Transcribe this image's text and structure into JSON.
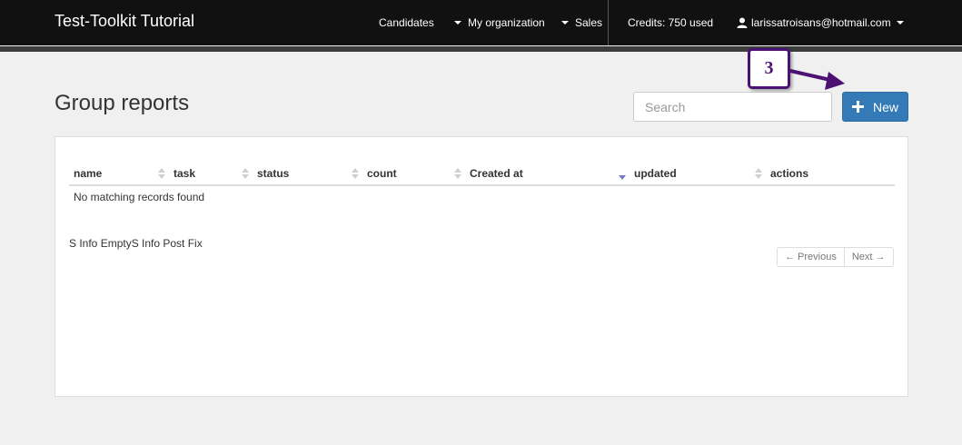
{
  "navbar": {
    "brand": "Test-Toolkit Tutorial",
    "items": [
      {
        "label": "Candidates"
      },
      {
        "label": "My organization"
      },
      {
        "label": "Sales"
      }
    ],
    "credits": "Credits: 750 used",
    "user_email": "larissatroisans@hotmail.com"
  },
  "page": {
    "title": "Group reports",
    "search_placeholder": "Search",
    "new_button_label": "New"
  },
  "annotation": {
    "step_number": "3",
    "color": "#4b1173"
  },
  "table": {
    "columns": [
      "name",
      "task",
      "status",
      "count",
      "Created at",
      "updated",
      "actions"
    ],
    "empty_message": "No matching records found",
    "sorted_column": "Created at",
    "sort_direction": "descending"
  },
  "footer": {
    "info_text": "S Info EmptyS Info Post Fix",
    "previous_label": "← Previous",
    "next_label": "Next →"
  },
  "colors": {
    "accent": "#337ab7",
    "navbar": "#111111"
  }
}
